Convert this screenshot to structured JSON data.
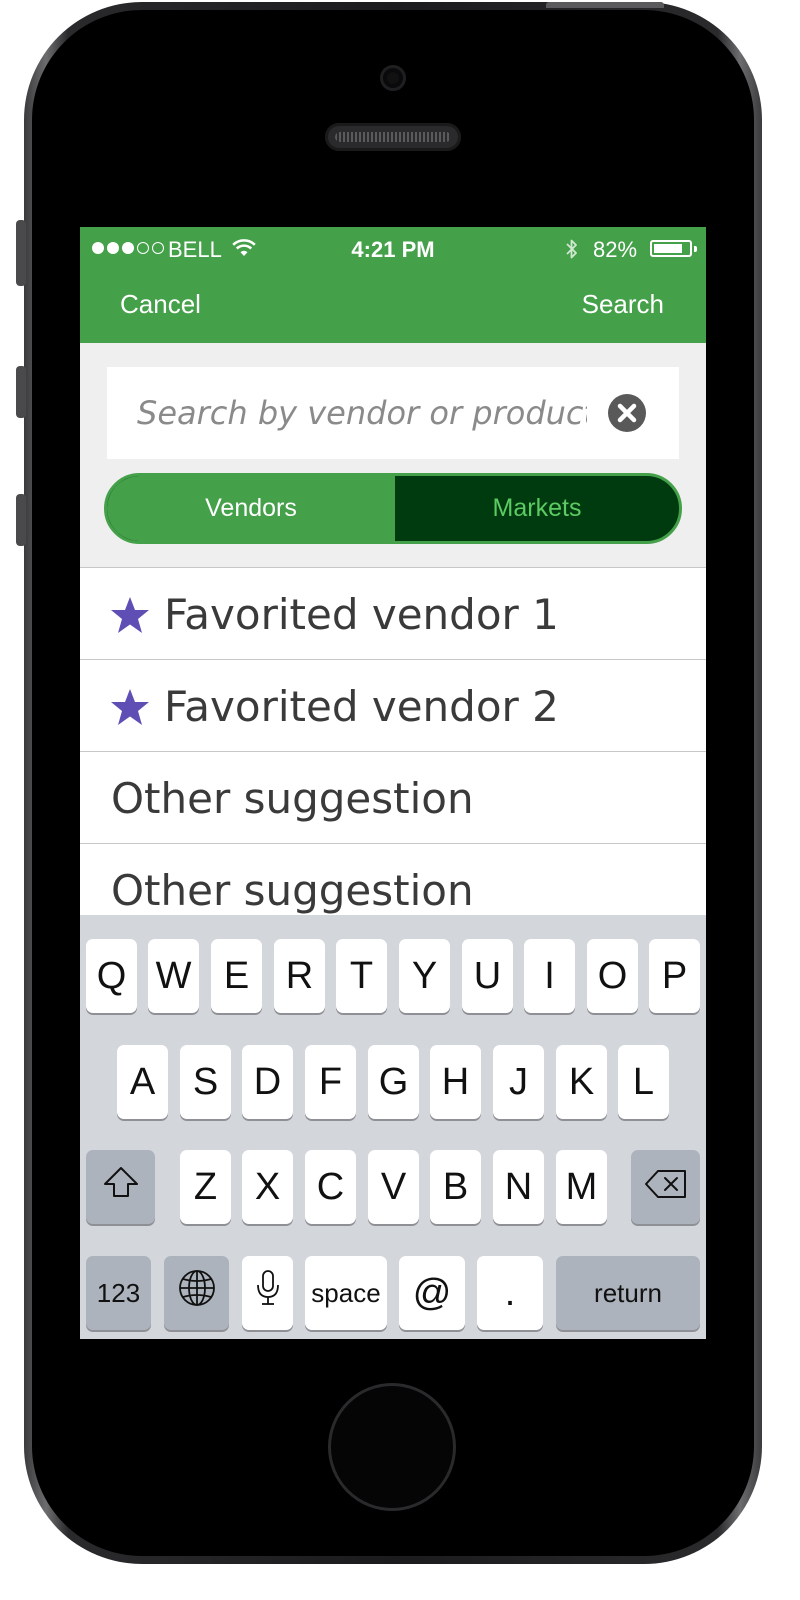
{
  "status_bar": {
    "carrier": "BELL",
    "time": "4:21 PM",
    "battery_percent": "82%",
    "battery_level": 0.82,
    "signal_bars_filled": 3,
    "signal_bars_total": 5
  },
  "nav": {
    "cancel_label": "Cancel",
    "search_label": "Search"
  },
  "search": {
    "placeholder": "Search by vendor or product",
    "value": ""
  },
  "segment": {
    "options": [
      "Vendors",
      "Markets"
    ],
    "selected": "Vendors"
  },
  "suggestions": [
    {
      "label": "Favorited vendor 1",
      "favorite": true
    },
    {
      "label": "Favorited vendor 2",
      "favorite": true
    },
    {
      "label": "Other suggestion",
      "favorite": false
    },
    {
      "label": "Other suggestion",
      "favorite": false
    }
  ],
  "keyboard": {
    "row1": [
      "Q",
      "W",
      "E",
      "R",
      "T",
      "Y",
      "U",
      "I",
      "O",
      "P"
    ],
    "row2": [
      "A",
      "S",
      "D",
      "F",
      "G",
      "H",
      "J",
      "K",
      "L"
    ],
    "row3": [
      "Z",
      "X",
      "C",
      "V",
      "B",
      "N",
      "M"
    ],
    "numbers_label": "123",
    "space_label": "space",
    "at_label": "@",
    "period_label": ".",
    "return_label": "return"
  },
  "colors": {
    "header_green": "#45a04a",
    "segment_dark": "#003b10",
    "segment_text_inactive": "#5ccb62",
    "star_purple": "#5f4fb5"
  },
  "icons": {
    "wifi": "wifi-icon",
    "bluetooth": "bluetooth-icon",
    "battery": "battery-icon",
    "clear": "clear-circle-x-icon",
    "star": "star-icon",
    "shift": "shift-arrow-icon",
    "delete": "backspace-icon",
    "globe": "globe-icon",
    "mic": "microphone-icon"
  }
}
